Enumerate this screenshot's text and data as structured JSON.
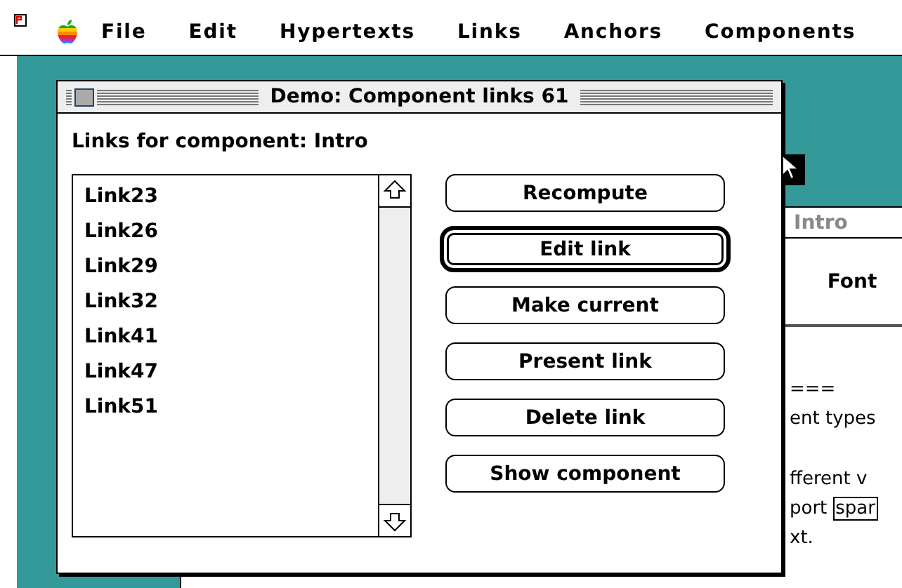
{
  "menu_bar": {
    "items": [
      "File",
      "Edit",
      "Hypertexts",
      "Links",
      "Anchors",
      "Components"
    ]
  },
  "background_window": {
    "title": "Intro",
    "header": "Font",
    "paragraphs": [
      [
        [
          {
            "text": "===",
            "boxed": false
          }
        ],
        [
          {
            "text": "ent types",
            "boxed": false
          }
        ]
      ],
      [
        [
          {
            "text": "fferent v",
            "boxed": false
          }
        ],
        [
          {
            "text": "port",
            "boxed": false
          },
          {
            "text": "spar",
            "boxed": true
          }
        ],
        [
          {
            "text": "xt.",
            "boxed": false
          }
        ]
      ]
    ]
  },
  "dialog": {
    "title": "Demo: Component links 61",
    "heading": "Links for component: Intro",
    "links": [
      {
        "label": "Link23",
        "selected": false
      },
      {
        "label": "Link26",
        "selected": false
      },
      {
        "label": "Link29",
        "selected": false
      },
      {
        "label": "Link32",
        "selected": false
      },
      {
        "label": "Link41",
        "selected": false
      },
      {
        "label": "Link47",
        "selected": false
      },
      {
        "label": "Link51",
        "selected": false
      }
    ],
    "buttons": [
      {
        "label": "Recompute",
        "default": false
      },
      {
        "label": "Edit link",
        "default": true
      },
      {
        "label": "Make current",
        "default": false
      },
      {
        "label": "Present link",
        "default": false
      },
      {
        "label": "Delete link",
        "default": false
      },
      {
        "label": "Show component",
        "default": false
      }
    ]
  }
}
